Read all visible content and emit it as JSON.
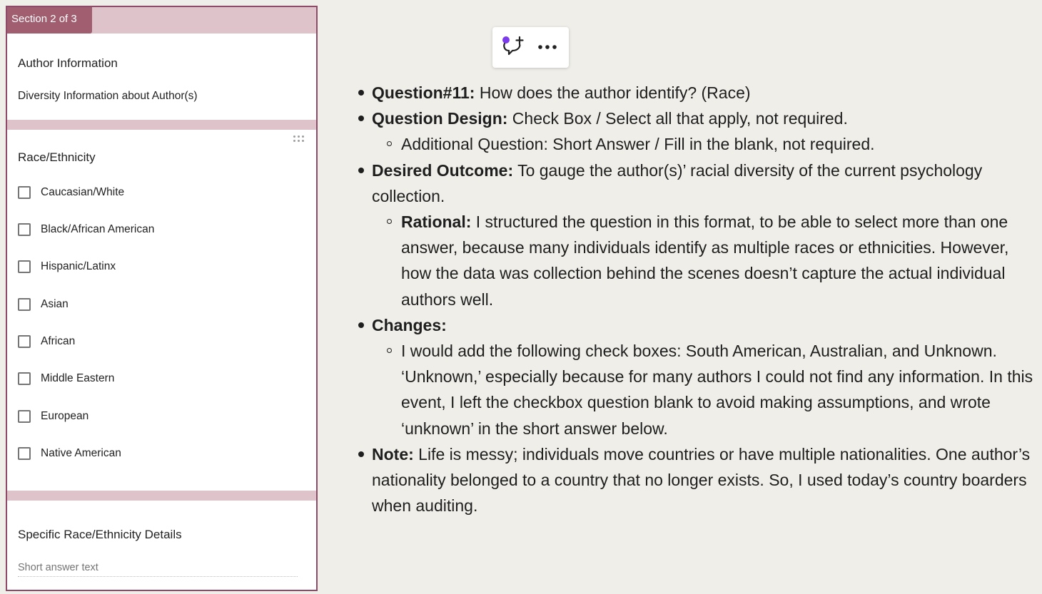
{
  "form": {
    "section_tab": "Section 2 of 3",
    "author_card": {
      "title": "Author Information",
      "subtitle": "Diversity Information about Author(s)"
    },
    "race_card": {
      "title": "Race/Ethnicity",
      "options": [
        "Caucasian/White",
        "Black/African American",
        "Hispanic/Latinx",
        "Asian",
        "African",
        "Middle Eastern",
        "European",
        "Native American"
      ]
    },
    "details_card": {
      "title": "Specific Race/Ethnicity Details",
      "placeholder": "Short answer text"
    }
  },
  "toolbar": {
    "icons": [
      "add-comment-icon",
      "more-options-icon"
    ],
    "accent_color": "#7c3aed"
  },
  "notes": {
    "q_label": "Question#11:",
    "q_text": " How does the author identify? (Race)",
    "design_label": "Question Design:",
    "design_text": " Check Box / Select all that apply, not required.",
    "design_sub": "Additional Question: Short Answer / Fill in the blank, not required.",
    "outcome_label": "Desired Outcome:",
    "outcome_text": " To gauge the author(s)’ racial diversity of the current psychology collection.",
    "rational_label": "Rational:",
    "rational_text": " I structured the question in this format, to be able to select more than one answer, because many individuals identify as multiple races or ethnicities. However, how the data was collection behind the scenes doesn’t capture the actual individual authors well.",
    "changes_label": "Changes:",
    "changes_sub": "I would add the following check boxes: South American, Australian, and Unknown. ‘Unknown,’ especially because for many authors I could not find any information. In this event, I left the checkbox question blank to avoid making assumptions, and wrote ‘unknown’ in the short answer below.",
    "note_label": "Note:",
    "note_text": " Life is messy; individuals move countries or have multiple nationalities. One author’s nationality belonged to a country that no longer exists. So, I used today’s country boarders when auditing."
  }
}
